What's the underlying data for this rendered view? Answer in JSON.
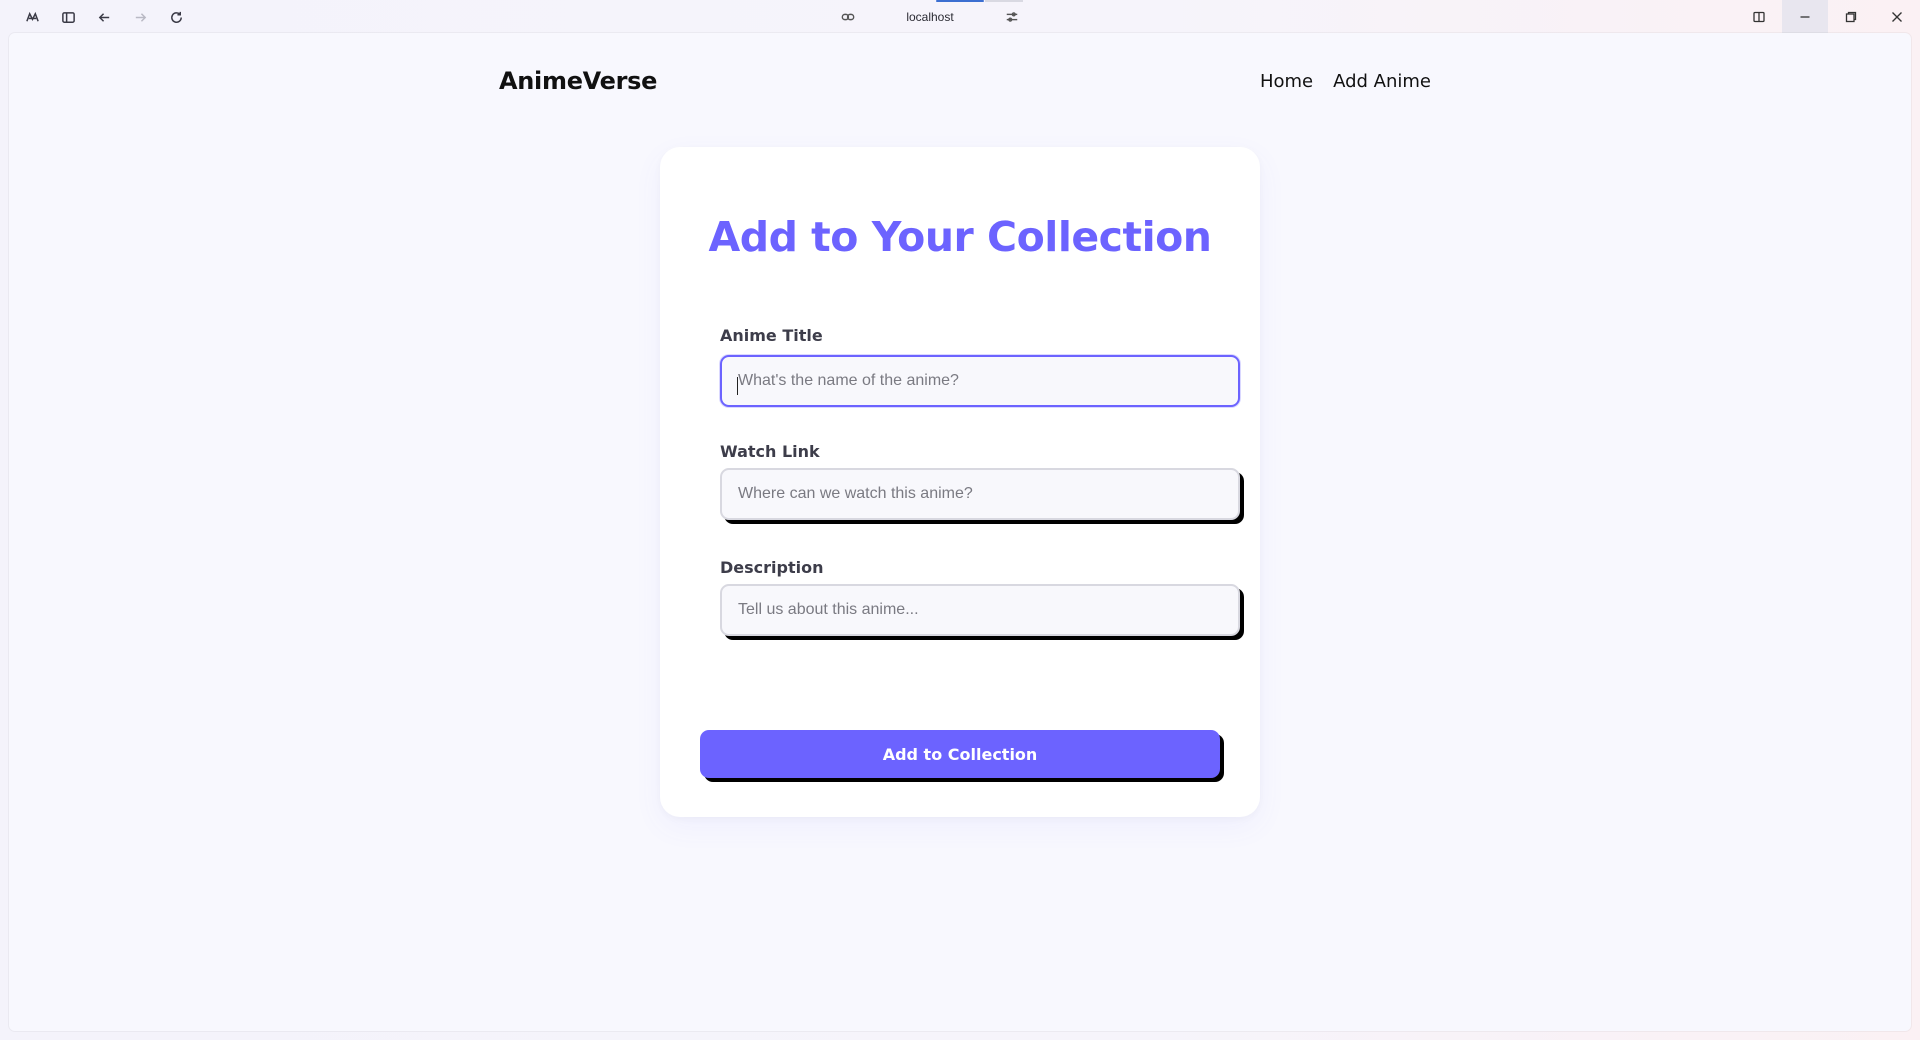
{
  "browser": {
    "url": "localhost"
  },
  "nav": {
    "brand": "AnimeVerse",
    "links": [
      "Home",
      "Add Anime"
    ]
  },
  "form": {
    "heading": "Add to Your Collection",
    "fields": [
      {
        "label": "Anime Title",
        "placeholder": "What's the name of the anime?",
        "value": ""
      },
      {
        "label": "Watch Link",
        "placeholder": "Where can we watch this anime?",
        "value": ""
      },
      {
        "label": "Description",
        "placeholder": "Tell us about this anime...",
        "value": ""
      }
    ],
    "submit_label": "Add to Collection"
  },
  "colors": {
    "accent": "#6c63ff",
    "page_bg": "#f8f8fe",
    "card_bg": "#ffffff",
    "shadow": "#000000"
  },
  "icons": {
    "browser_toolbar": [
      "app-logo-icon",
      "sidebar-toggle-icon",
      "back-arrow-icon",
      "forward-arrow-icon",
      "reload-icon"
    ],
    "address_bar": [
      "link-icon",
      "tune-icon"
    ],
    "window_controls": [
      "split-view-icon",
      "minimize-icon",
      "restore-icon",
      "close-icon"
    ]
  }
}
